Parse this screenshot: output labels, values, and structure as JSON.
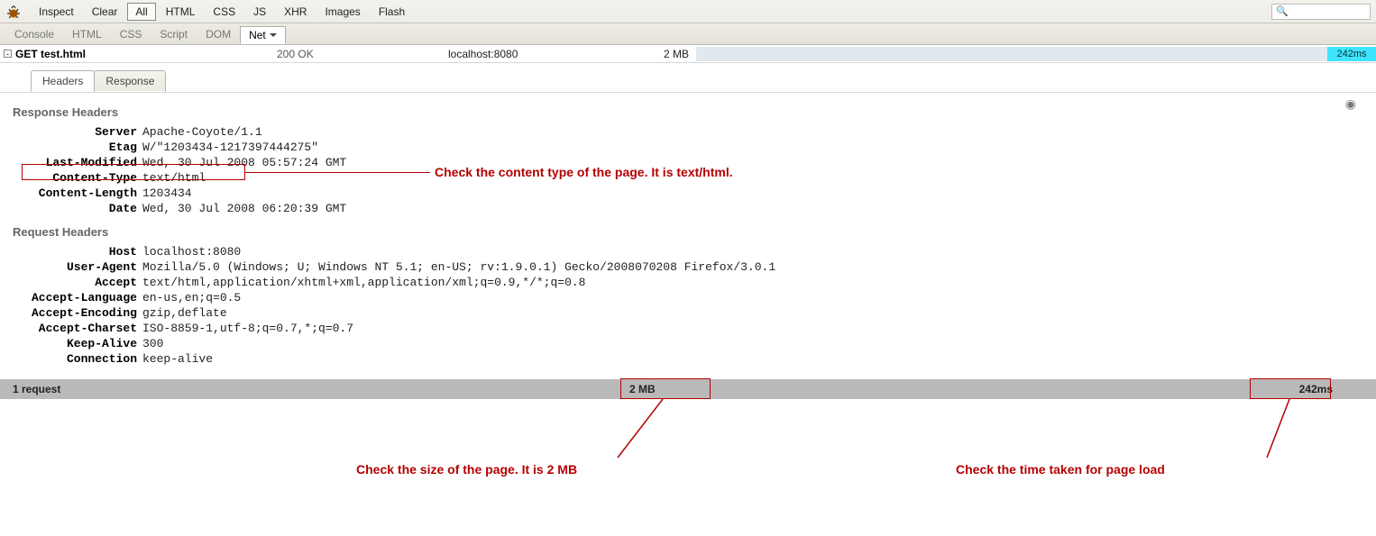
{
  "toolbar": {
    "inspect": "Inspect",
    "clear": "Clear",
    "all": "All",
    "html": "HTML",
    "css": "CSS",
    "js": "JS",
    "xhr": "XHR",
    "images": "Images",
    "flash": "Flash",
    "search_icon": "🔍"
  },
  "panelTabs": {
    "console": "Console",
    "html": "HTML",
    "css": "CSS",
    "script": "Script",
    "dom": "DOM",
    "net": "Net"
  },
  "request": {
    "toggle": "-",
    "label": "GET test.html",
    "status": "200 OK",
    "domain": "localhost:8080",
    "size": "2 MB",
    "time": "242ms"
  },
  "subTabs": {
    "headers": "Headers",
    "response": "Response"
  },
  "responseHeadersTitle": "Response Headers",
  "requestHeadersTitle": "Request Headers",
  "responseHeaders": [
    {
      "n": "Server",
      "v": "Apache-Coyote/1.1"
    },
    {
      "n": "Etag",
      "v": "W/\"1203434-1217397444275\""
    },
    {
      "n": "Last-Modified",
      "v": "Wed, 30 Jul 2008 05:57:24 GMT"
    },
    {
      "n": "Content-Type",
      "v": "text/html"
    },
    {
      "n": "Content-Length",
      "v": "1203434"
    },
    {
      "n": "Date",
      "v": "Wed, 30 Jul 2008 06:20:39 GMT"
    }
  ],
  "requestHeaders": [
    {
      "n": "Host",
      "v": "localhost:8080"
    },
    {
      "n": "User-Agent",
      "v": "Mozilla/5.0 (Windows; U; Windows NT 5.1; en-US; rv:1.9.0.1) Gecko/2008070208 Firefox/3.0.1"
    },
    {
      "n": "Accept",
      "v": "text/html,application/xhtml+xml,application/xml;q=0.9,*/*;q=0.8"
    },
    {
      "n": "Accept-Language",
      "v": "en-us,en;q=0.5"
    },
    {
      "n": "Accept-Encoding",
      "v": "gzip,deflate"
    },
    {
      "n": "Accept-Charset",
      "v": "ISO-8859-1,utf-8;q=0.7,*;q=0.7"
    },
    {
      "n": "Keep-Alive",
      "v": "300"
    },
    {
      "n": "Connection",
      "v": "keep-alive"
    }
  ],
  "summary": {
    "requests": "1 request",
    "size": "2 MB",
    "time": "242ms"
  },
  "annotations": {
    "contentType": "Check the content type of the page. It is text/html.",
    "size": "Check the size of the page. It is 2 MB",
    "time": "Check the time taken for page load"
  }
}
